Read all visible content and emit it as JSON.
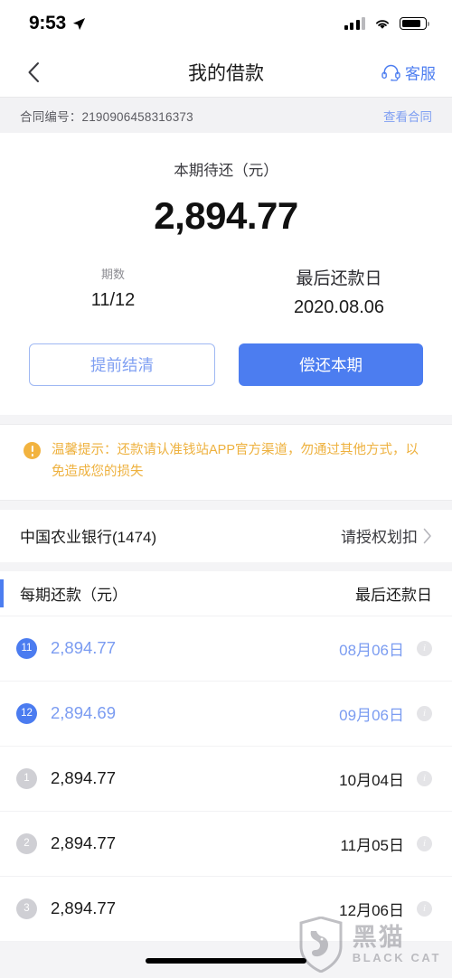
{
  "status_bar": {
    "time": "9:53",
    "location_icon": "location-arrow-icon",
    "signal_icon": "cellular-signal-icon",
    "wifi_icon": "wifi-icon",
    "battery_icon": "battery-icon"
  },
  "nav": {
    "back_icon": "chevron-left-icon",
    "title": "我的借款",
    "service_icon": "headset-icon",
    "service_label": "客服"
  },
  "contract": {
    "label": "合同编号：",
    "number": "2190906458316373",
    "view_link": "查看合同"
  },
  "summary": {
    "due_label": "本期待还（元）",
    "due_amount": "2,894.77",
    "period_label": "期数",
    "period_value": "11/12",
    "final_date_label": "最后还款日",
    "final_date_value": "2020.08.06",
    "settle_early_button": "提前结清",
    "repay_button": "偿还本期"
  },
  "warning": {
    "icon": "exclamation-circle-icon",
    "text": "温馨提示：还款请认准钱站APP官方渠道，勿通过其他方式，以免造成您的损失"
  },
  "bank": {
    "name": "中国农业银行(1474)",
    "action": "请授权划扣",
    "chevron_icon": "chevron-right-icon"
  },
  "schedule": {
    "amount_header": "每期还款（元）",
    "date_header": "最后还款日",
    "info_icon": "info-circle-icon",
    "rows": [
      {
        "period": "11",
        "amount": "2,894.77",
        "date": "08月06日",
        "state": "active"
      },
      {
        "period": "12",
        "amount": "2,894.69",
        "date": "09月06日",
        "state": "active"
      },
      {
        "period": "1",
        "amount": "2,894.77",
        "date": "10月04日",
        "state": "idle"
      },
      {
        "period": "2",
        "amount": "2,894.77",
        "date": "11月05日",
        "state": "idle"
      },
      {
        "period": "3",
        "amount": "2,894.77",
        "date": "12月06日",
        "state": "idle"
      }
    ]
  },
  "watermark": {
    "shield_icon": "black-cat-shield-icon",
    "cn": "黑猫",
    "en": "BLACK CAT"
  },
  "colors": {
    "primary_blue": "#4c7df0",
    "link_blue": "#7f9ff2",
    "warning_amber": "#eeb13e",
    "idle_gray": "#cfcfd4",
    "page_bg": "#f4f4f6"
  }
}
